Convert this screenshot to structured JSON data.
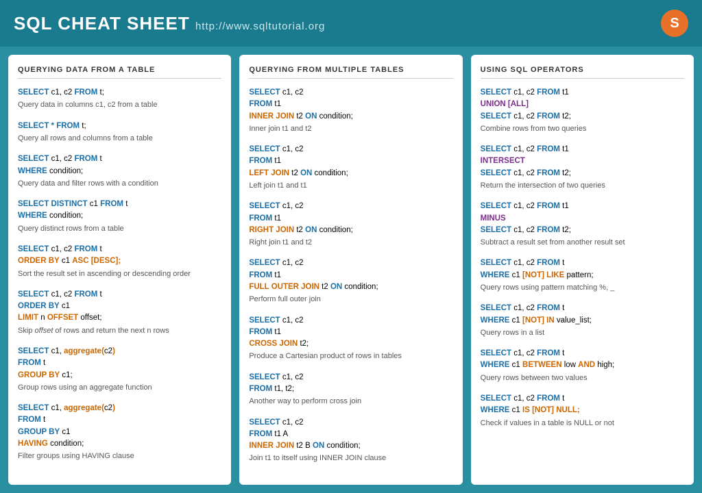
{
  "header": {
    "title": "SQL CHEAT SHEET",
    "url": "http://www.sqltutorial.org",
    "logo": "S"
  },
  "panels": [
    {
      "id": "querying-single",
      "title": "QUERYING DATA FROM A TABLE",
      "sections": []
    },
    {
      "id": "querying-multiple",
      "title": "QUERYING FROM MULTIPLE TABLES",
      "sections": []
    },
    {
      "id": "sql-operators",
      "title": "USING SQL OPERATORS",
      "sections": []
    }
  ]
}
